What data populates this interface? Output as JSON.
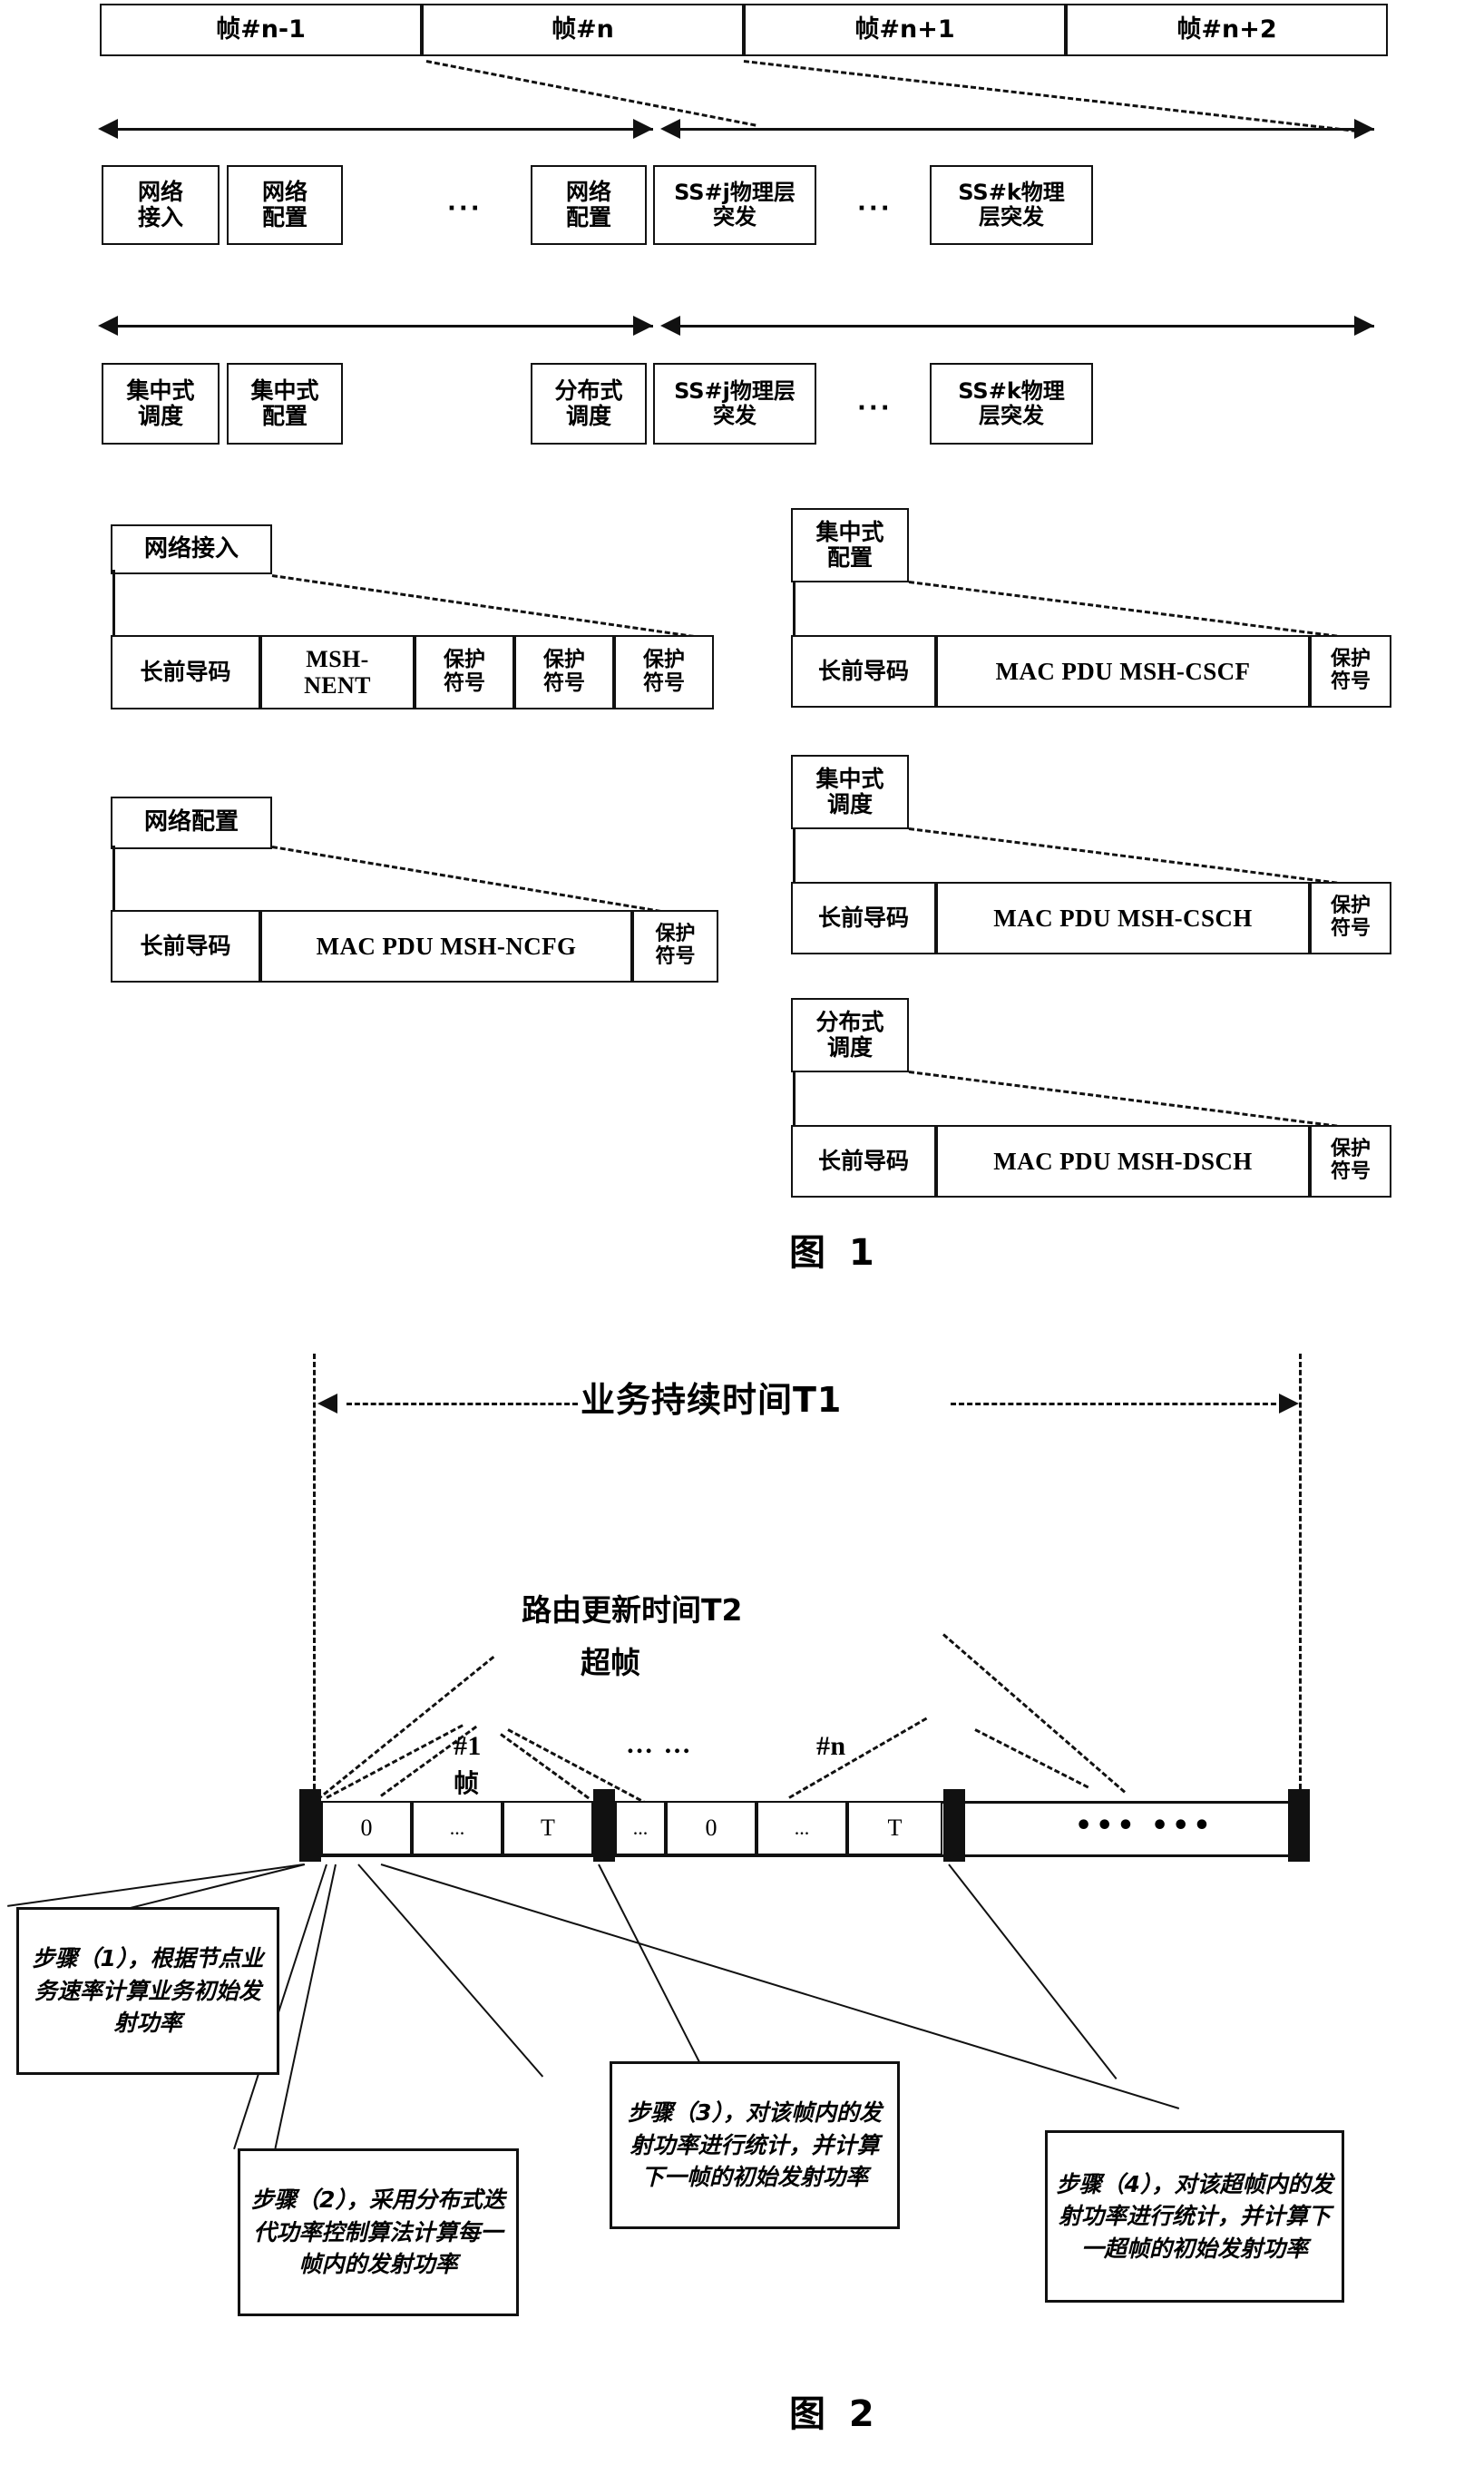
{
  "figure1": {
    "label": "图 1",
    "row_superframe": {
      "name": "superframe-row",
      "cells": [
        "帧#n-1",
        "帧#n",
        "帧#n+1",
        "帧#n+2"
      ]
    },
    "row_control": {
      "name": "control-subframe-row",
      "cells": [
        "网络\n接入",
        "网络\n配置",
        "网络\n配置",
        "SS#j物理层\n突发",
        "SS#k物理\n层突发"
      ],
      "ellipsis": "···"
    },
    "row_schedule": {
      "name": "schedule-subframe-row",
      "cells": [
        "集中式\n调度",
        "集中式\n配置",
        "分布式\n调度",
        "SS#j物理层\n突发",
        "SS#k物理\n层突发"
      ],
      "ellipsis": "···"
    },
    "details": [
      {
        "title": "网络接入",
        "fields": [
          "长前导码",
          "MSH-\nNENT",
          "保护\n符号",
          "保护\n符号",
          "保护\n符号"
        ]
      },
      {
        "title": "网络配置",
        "fields": [
          "长前导码",
          "MAC PDU MSH-NCFG",
          "保护\n符号"
        ]
      },
      {
        "title": "集中式\n配置",
        "fields": [
          "长前导码",
          "MAC PDU MSH-CSCF",
          "保护\n符号"
        ]
      },
      {
        "title": "集中式\n调度",
        "fields": [
          "长前导码",
          "MAC PDU MSH-CSCH",
          "保护\n符号"
        ]
      },
      {
        "title": "分布式\n调度",
        "fields": [
          "长前导码",
          "MAC PDU MSH-DSCH",
          "保护\n符号"
        ]
      }
    ]
  },
  "figure2": {
    "label": "图 2",
    "service_duration": "业务持续时间T1",
    "route_update": "路由更新时间T2",
    "superframe_word": "超帧",
    "frame_marks": {
      "first": "#1",
      "first_sub": "帧",
      "middle_ellipsis": "… …",
      "last": "#n"
    },
    "timeline_cells_group1": [
      "0",
      "...",
      "T"
    ],
    "timeline_cells_group2": [
      "...",
      "0",
      "...",
      "T"
    ],
    "tail_dots": "••• •••",
    "steps": [
      "步骤（1），根据节点业务速率计算业务初始发射功率",
      "步骤（2），采用分布式迭代功率控制算法计算每一帧内的发射功率",
      "步骤（3），对该帧内的发射功率进行统计，并计算下一帧的初始发射功率",
      "步骤（4），对该超帧内的发射功率进行统计，并计算下一超帧的初始发射功率"
    ]
  },
  "colors": {
    "ink": "#111111",
    "paper": "#ffffff"
  }
}
